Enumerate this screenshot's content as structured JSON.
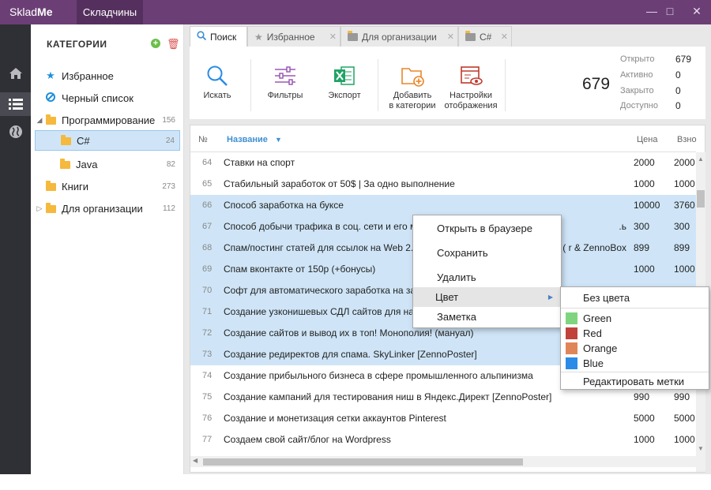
{
  "app": {
    "logo_light": "Sklad",
    "logo_bold": "Me",
    "tab": "Складчины"
  },
  "window": {
    "minimize": "—",
    "maximize": "□",
    "close": "✕"
  },
  "categories": {
    "title": "КАТЕГОРИИ",
    "add": "+",
    "delete": "🗑",
    "items": [
      {
        "label": "Избранное",
        "count": ""
      },
      {
        "label": "Черный список",
        "count": ""
      },
      {
        "label": "Программирование",
        "count": "156"
      },
      {
        "label": "C#",
        "count": "24"
      },
      {
        "label": "Java",
        "count": "82"
      },
      {
        "label": "Книги",
        "count": "273"
      },
      {
        "label": "Для организации",
        "count": "112"
      }
    ]
  },
  "tabs": [
    {
      "label": "Поиск"
    },
    {
      "label": "Избранное"
    },
    {
      "label": "Для организации"
    },
    {
      "label": "C#"
    }
  ],
  "toolbar": {
    "search": "Искать",
    "filters": "Фильтры",
    "export": "Экспорт",
    "add_cat_1": "Добавить",
    "add_cat_2": "в категории",
    "display_1": "Настройки",
    "display_2": "отображения"
  },
  "stats": {
    "total": "679",
    "rows": [
      {
        "label": "Открыто",
        "value": "679"
      },
      {
        "label": "Активно",
        "value": "0"
      },
      {
        "label": "Закрыто",
        "value": "0"
      },
      {
        "label": "Доступно",
        "value": "0"
      }
    ]
  },
  "grid": {
    "headers": {
      "num": "№",
      "name": "Название",
      "price": "Цена",
      "contrib": "Взно"
    },
    "rows": [
      {
        "num": "64",
        "name": "Ставки на спорт",
        "price": "2000",
        "contrib": "2000",
        "selected": false
      },
      {
        "num": "65",
        "name": "Стабильный заработок от 50$ | За одно выполнение",
        "price": "1000",
        "contrib": "1000",
        "selected": false
      },
      {
        "num": "66",
        "name": "Способ заработка на буксе",
        "price": "10000",
        "contrib": "3760",
        "selected": true
      },
      {
        "num": "67",
        "name": "Способ добычи трафика в соц. сети и его м",
        "tail": "ь.",
        "price": "300",
        "contrib": "300",
        "selected": true
      },
      {
        "num": "68",
        "name": "Спам/постинг статей для ссылок на Web 2.0",
        "tail": "r & ZennoBox )",
        "price": "899",
        "contrib": "899",
        "selected": true
      },
      {
        "num": "69",
        "name": "Спам вконтакте от 150р (+бонусы)",
        "price": "1000",
        "contrib": "1000",
        "selected": true
      },
      {
        "num": "70",
        "name": "Софт для автоматического заработка на зар",
        "price": "",
        "contrib": "",
        "selected": true
      },
      {
        "num": "71",
        "name": "Создание узконишевых СДЛ сайтов для нач",
        "price": "",
        "contrib": "",
        "selected": true
      },
      {
        "num": "72",
        "name": "Создание сайтов и вывод их в топ! Монополия! (мануал)",
        "price": "",
        "contrib": "",
        "selected": true
      },
      {
        "num": "73",
        "name": "Создание редиректов для спама. SkyLinker [ZennoPoster]",
        "price": "",
        "contrib": "",
        "selected": true
      },
      {
        "num": "74",
        "name": "Создание прибыльного бизнеса в сфере промышленного альпинизма",
        "price": "",
        "contrib": "",
        "selected": false
      },
      {
        "num": "75",
        "name": "Создание кампаний для тестирования ниш в Яндекс.Директ [ZennoPoster]",
        "price": "990",
        "contrib": "990",
        "selected": false
      },
      {
        "num": "76",
        "name": "Создание и монетизация сетки аккаунтов Pinterest",
        "price": "5000",
        "contrib": "5000",
        "selected": false
      },
      {
        "num": "77",
        "name": "Создаем свой сайт/блог на Wordpress",
        "price": "1000",
        "contrib": "1000",
        "selected": false
      }
    ]
  },
  "context_menu": {
    "items": [
      "Открыть в браузере",
      "Сохранить",
      "Удалить",
      "Цвет",
      "Заметка"
    ],
    "submenu_arrow": "▶"
  },
  "color_submenu": {
    "none": "Без цвета",
    "colors": [
      {
        "label": "Green",
        "color": "#7fd47f"
      },
      {
        "label": "Red",
        "color": "#c0423b"
      },
      {
        "label": "Orange",
        "color": "#e0855a"
      },
      {
        "label": "Blue",
        "color": "#2b8be6"
      }
    ],
    "edit": "Редактировать метки"
  },
  "colors": {
    "accent": "#6b3f76",
    "selection": "#cfe5f7",
    "link": "#3f8fd2"
  }
}
